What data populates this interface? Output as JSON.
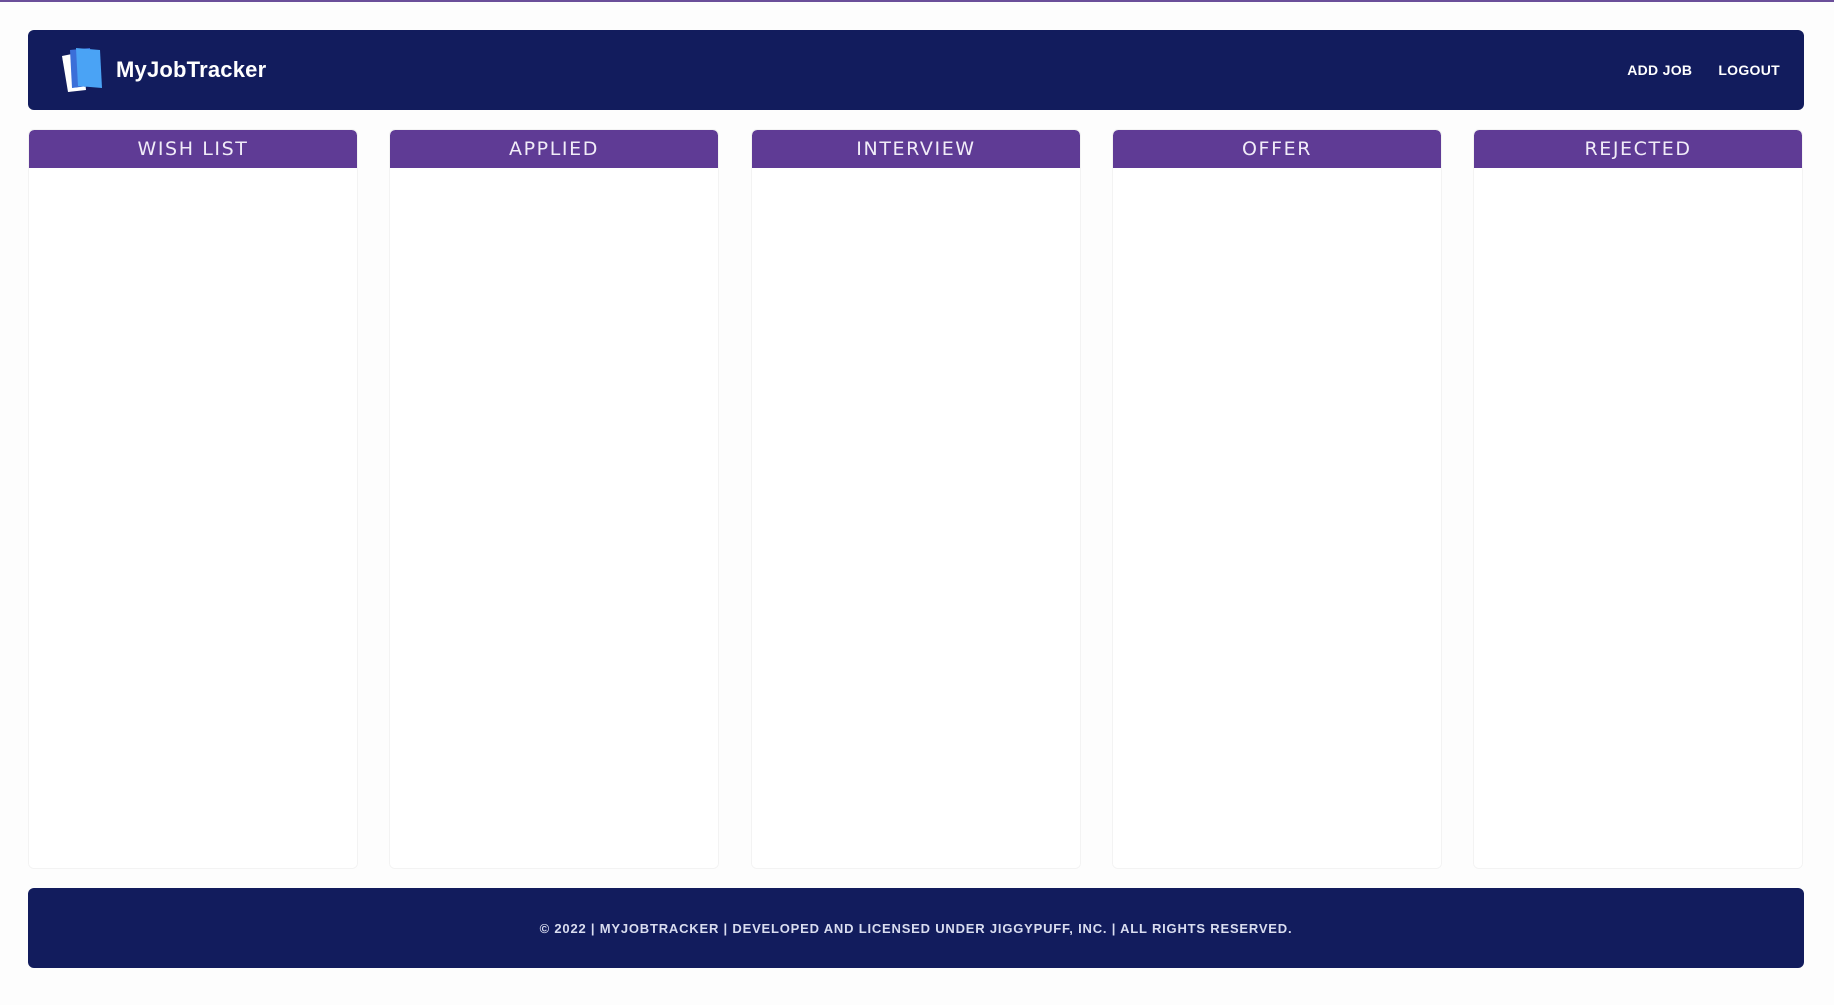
{
  "brand": {
    "name": "MyJobTracker",
    "logo_icon": "book-logo-icon",
    "colors": {
      "header_bg": "#121c5d",
      "column_header_bg": "#5f3b95",
      "logo_blue": "#4aa3f5"
    }
  },
  "nav": {
    "add_job": "ADD JOB",
    "logout": "LOGOUT"
  },
  "columns": [
    {
      "title": "WISH LIST"
    },
    {
      "title": "APPLIED"
    },
    {
      "title": "INTERVIEW"
    },
    {
      "title": "OFFER"
    },
    {
      "title": "REJECTED"
    }
  ],
  "footer": {
    "text": "© 2022 | MYJOBTRACKER | DEVELOPED AND LICENSED UNDER JIGGYPUFF, INC. | ALL RIGHTS RESERVED."
  }
}
